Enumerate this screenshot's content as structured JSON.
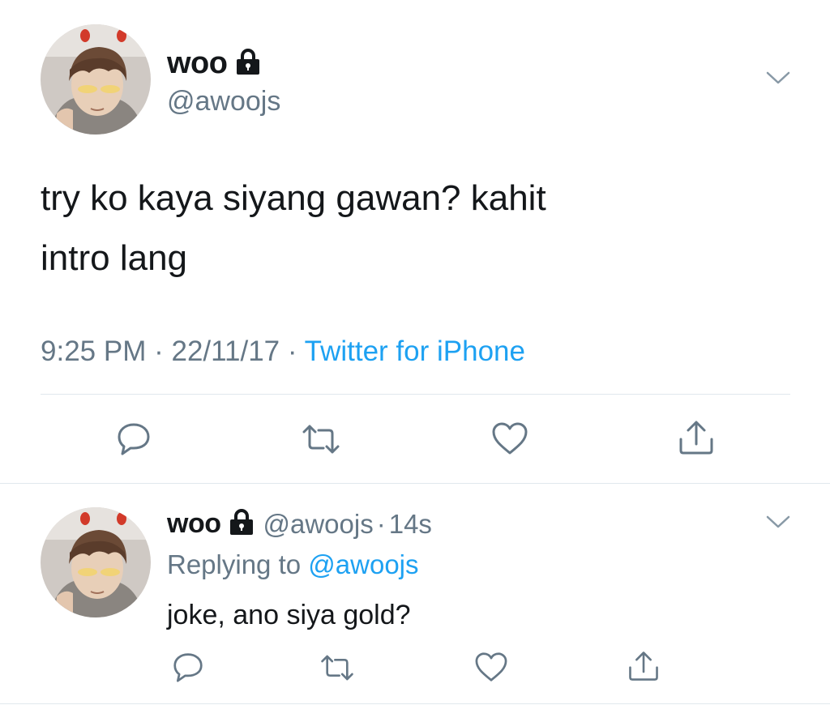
{
  "main_tweet": {
    "author": {
      "name": "woo",
      "handle": "@awoojs",
      "protected_icon": "lock-icon"
    },
    "text_line1": "try ko kaya siyang gawan? kahit",
    "text_line2": "intro lang",
    "time": "9:25 PM",
    "date": "22/11/17",
    "source": "Twitter for iPhone",
    "separator": "·",
    "actions": [
      "reply-icon",
      "retweet-icon",
      "like-icon",
      "share-icon"
    ]
  },
  "reply_tweet": {
    "author": {
      "name": "woo",
      "handle": "@awoojs",
      "protected_icon": "lock-icon"
    },
    "timestamp": "14s",
    "separator": "·",
    "replying_prefix": "Replying to",
    "replying_to": "@awoojs",
    "text": "joke, ano siya gold?",
    "actions": [
      "reply-icon",
      "retweet-icon",
      "like-icon",
      "share-icon"
    ]
  },
  "colors": {
    "text": "#14171a",
    "secondary": "#657786",
    "link": "#1da1f2",
    "divider": "#e1e8ed",
    "icon": "#657786"
  }
}
